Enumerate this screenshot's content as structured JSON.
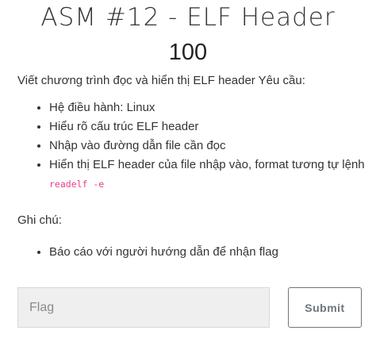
{
  "challenge": {
    "title": "ASM #12 - ELF Header",
    "value": "100"
  },
  "description": {
    "intro": "Viết chương trình đọc và hiển thị ELF header Yêu cầu:",
    "requirements": [
      "Hệ điều hành: Linux",
      "Hiểu rõ cấu trúc ELF header",
      "Nhập vào đường dẫn file cần đọc"
    ],
    "last_requirement_prefix": "Hiển thị ELF header của file nhập vào, format tương tự lệnh ",
    "last_requirement_code": "readelf -e"
  },
  "notes": {
    "label": "Ghi chú:",
    "items": [
      "Báo cáo với người hướng dẫn để nhận flag"
    ]
  },
  "form": {
    "flag_placeholder": "Flag",
    "flag_value": "",
    "submit_label": "Submit"
  }
}
